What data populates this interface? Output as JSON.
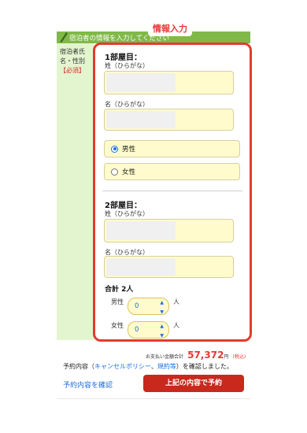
{
  "header": {
    "section_title": "宿泊者の情報を入力してください",
    "badge": "情報入力"
  },
  "side": {
    "label_line1": "宿泊者氏",
    "label_line2": "名・性別",
    "required": "【必須】"
  },
  "room1": {
    "title": "1部屋目：",
    "sei_label": "姓（ひらがな）",
    "mei_label": "名（ひらがな）",
    "sei_value": "",
    "mei_value": "",
    "gender_male": "男性",
    "gender_female": "女性",
    "selected_gender": "男性"
  },
  "room2": {
    "title": "2部屋目：",
    "sei_label": "姓（ひらがな）",
    "mei_label": "名（ひらがな）",
    "sei_value": "",
    "mei_value": ""
  },
  "totals": {
    "total_people": "合計 2人",
    "male_label": "男性",
    "male_value": "0",
    "female_label": "女性",
    "female_value": "0",
    "unit": "人"
  },
  "payment": {
    "label": "お支払い金額合計",
    "amount": "57,372",
    "currency": "円",
    "tax": "(税込)"
  },
  "confirm": {
    "prefix": "予約内容（",
    "cancel_policy": "キャンセルポリシー",
    "sep": "、",
    "rules": "規約等",
    "suffix": "）を確認しました。"
  },
  "actions": {
    "check_link": "予約内容を確認",
    "submit": "上記の内容で予約"
  },
  "colors": {
    "accent_red": "#e23b2e",
    "header_green": "#80b948",
    "input_yellow": "#fffbcc",
    "link_blue": "#1e6fe0"
  }
}
